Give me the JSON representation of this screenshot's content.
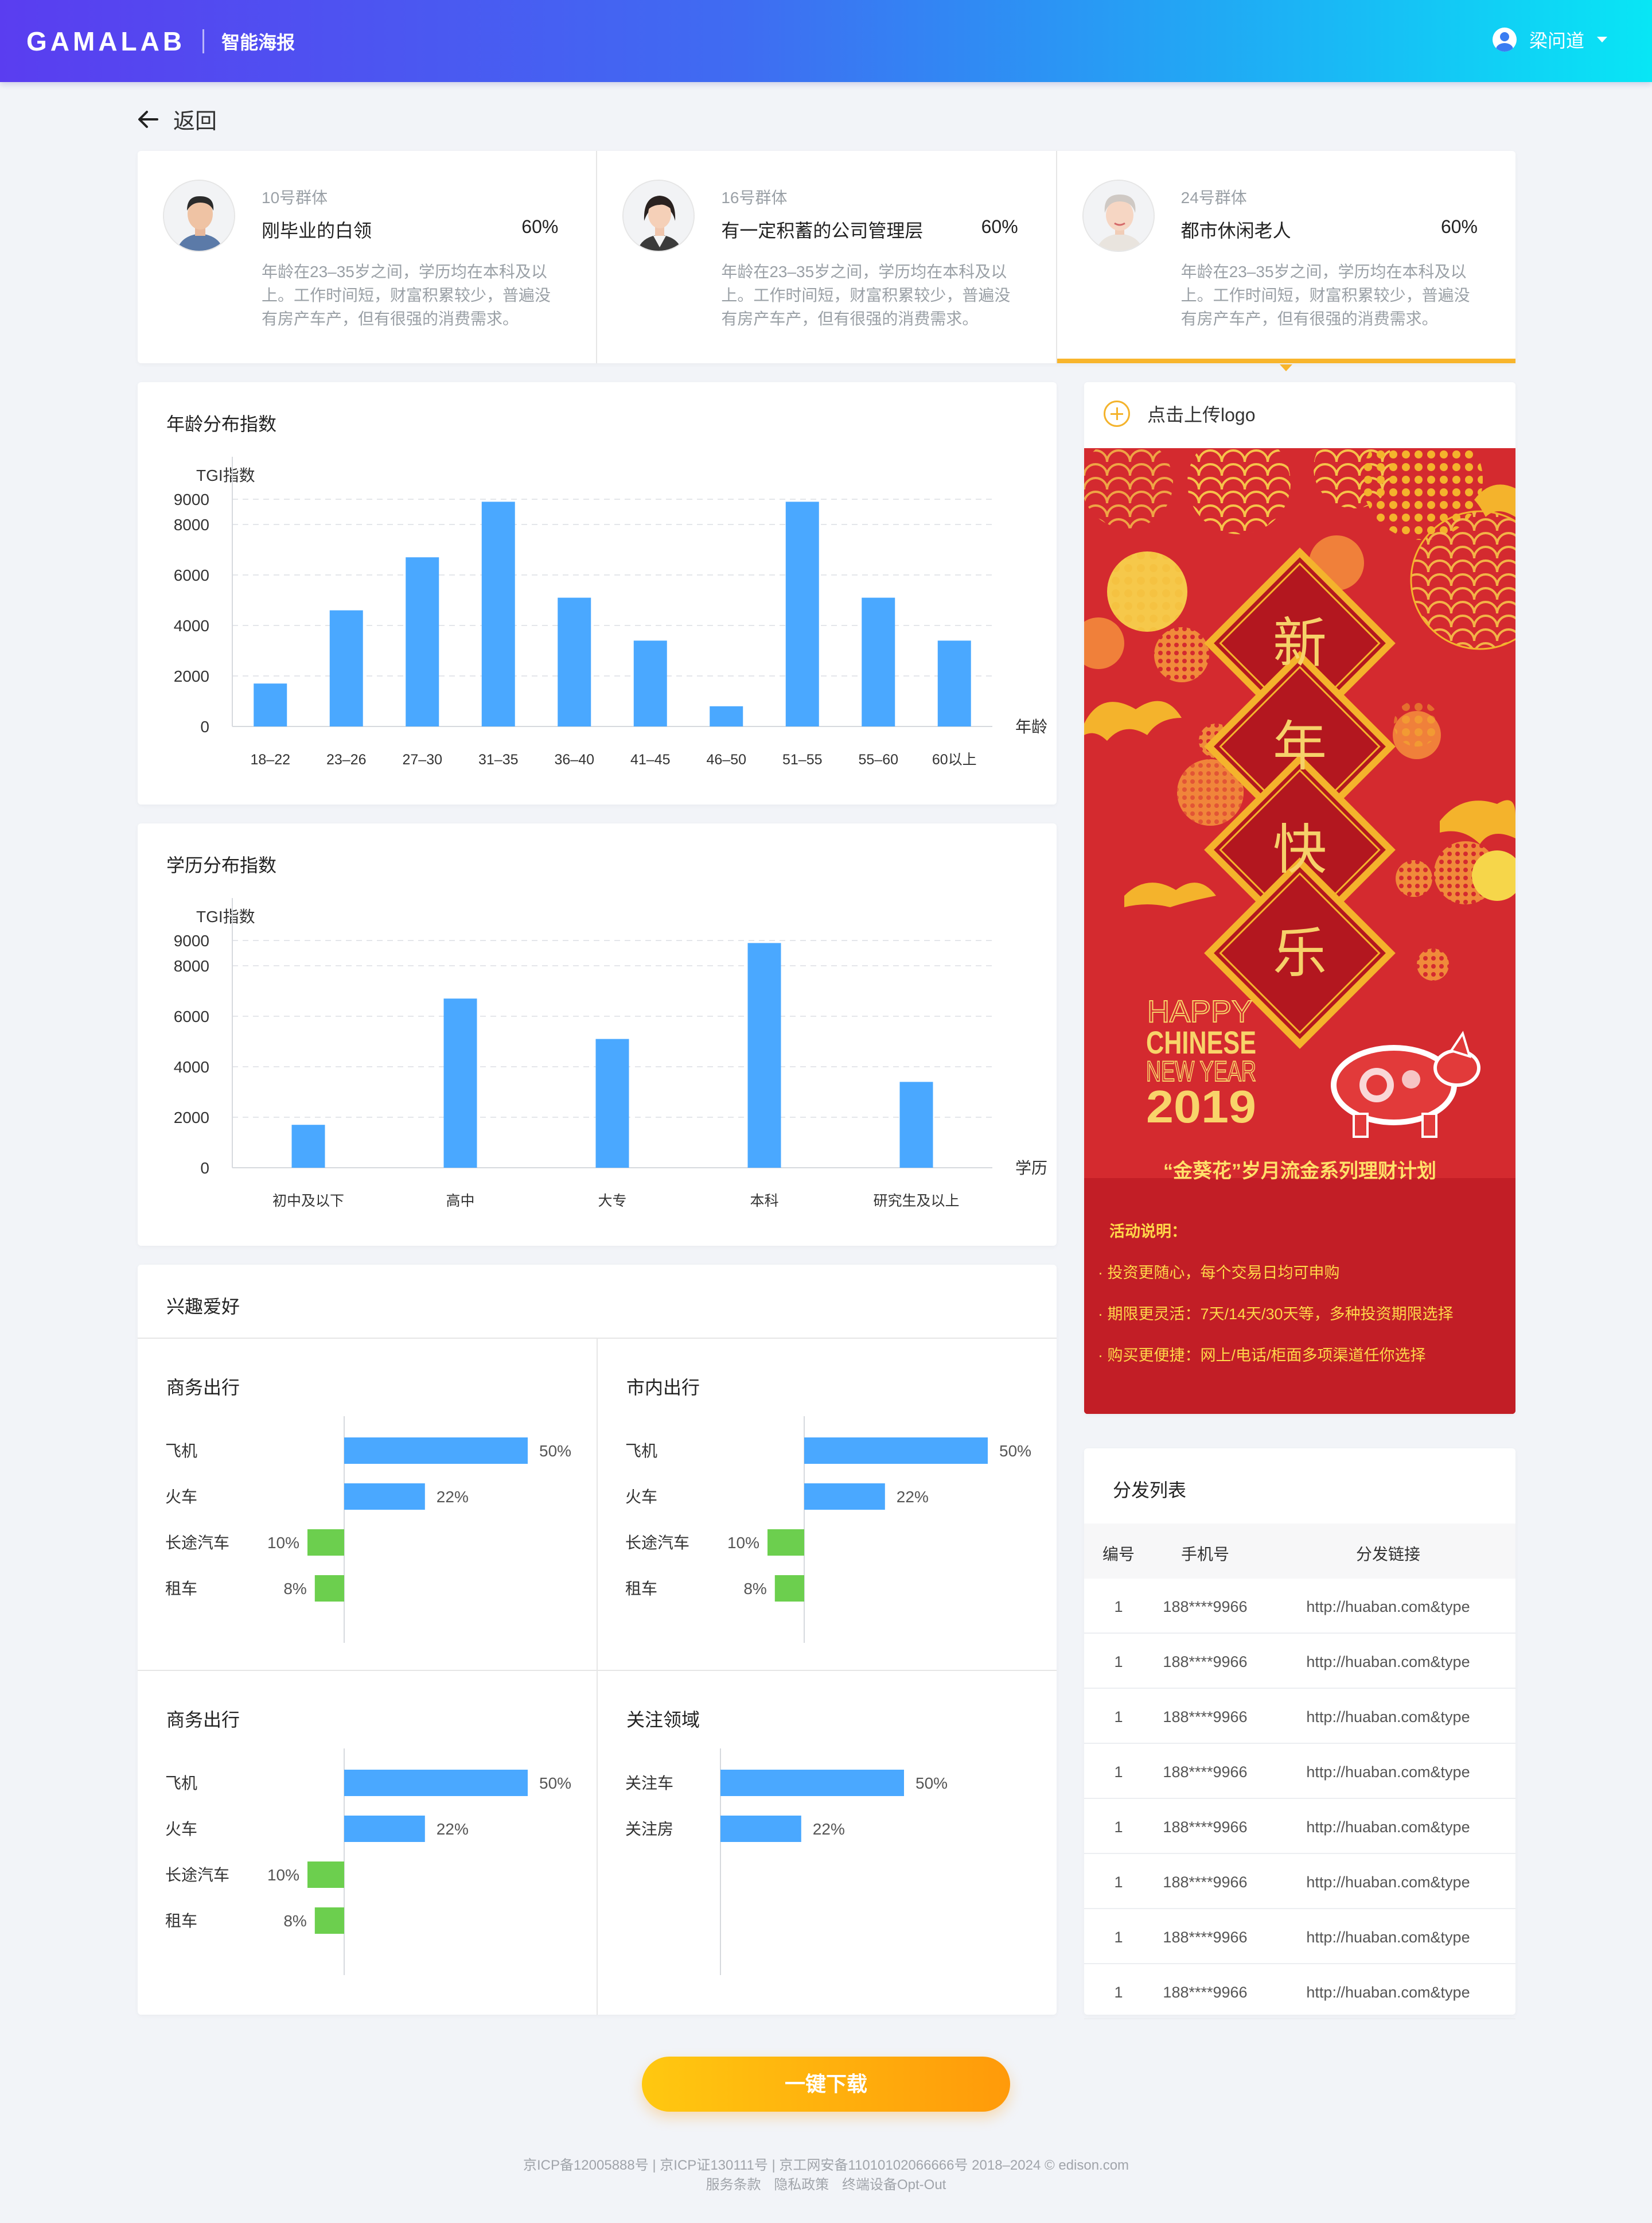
{
  "header": {
    "logo": "GAMALAB",
    "product": "智能海报",
    "user": "梁问道"
  },
  "back_label": "返回",
  "personas": [
    {
      "group": "10号群体",
      "name": "刚毕业的白领",
      "percent": "60%",
      "desc": "年龄在23–35岁之间，学历均在本科及以上。工作时间短，财富积累较少，普遍没有房产车产，但有很强的消费需求。"
    },
    {
      "group": "16号群体",
      "name": "有一定积蓄的公司管理层",
      "percent": "60%",
      "desc": "年龄在23–35岁之间，学历均在本科及以上。工作时间短，财富积累较少，普遍没有房产车产，但有很强的消费需求。"
    },
    {
      "group": "24号群体",
      "name": "都市休闲老人",
      "percent": "60%",
      "desc": "年龄在23–35岁之间，学历均在本科及以上。工作时间短，财富积累较少，普遍没有房产车产，但有很强的消费需求。"
    }
  ],
  "age_chart": {
    "title": "年龄分布指数",
    "ylabel": "TGI指数",
    "xlabel": "年龄"
  },
  "edu_chart": {
    "title": "学历分布指数",
    "ylabel": "TGI指数",
    "xlabel": "学历"
  },
  "chart_data": [
    {
      "type": "bar",
      "title": "年龄分布指数",
      "ylabel": "TGI指数",
      "xlabel": "年龄",
      "categories": [
        "18–22",
        "23–26",
        "27–30",
        "31–35",
        "36–40",
        "41–45",
        "46–50",
        "51–55",
        "55–60",
        "60以上"
      ],
      "values": [
        1700,
        4600,
        6700,
        8900,
        5100,
        3400,
        800,
        8900,
        5100,
        3400
      ],
      "yticks": [
        0,
        2000,
        4000,
        6000,
        8000,
        9000
      ],
      "ylim": [
        0,
        10000
      ],
      "color": "#4aa8ff",
      "grid": true
    },
    {
      "type": "bar",
      "title": "学历分布指数",
      "ylabel": "TGI指数",
      "xlabel": "学历",
      "categories": [
        "初中及以下",
        "高中",
        "大专",
        "本科",
        "研究生及以上"
      ],
      "values": [
        1700,
        6700,
        5100,
        8900,
        3400
      ],
      "yticks": [
        0,
        2000,
        4000,
        6000,
        8000,
        9000
      ],
      "ylim": [
        0,
        10000
      ],
      "color": "#4aa8ff",
      "grid": true
    },
    {
      "type": "bar",
      "title": "商务出行",
      "orientation": "horizontal",
      "categories": [
        "飞机",
        "火车",
        "长途汽车",
        "租车"
      ],
      "values": [
        50,
        22,
        -10,
        -8
      ],
      "labels": [
        "50%",
        "22%",
        "10%",
        "8%"
      ]
    },
    {
      "type": "bar",
      "title": "市内出行",
      "orientation": "horizontal",
      "categories": [
        "飞机",
        "火车",
        "长途汽车",
        "租车"
      ],
      "values": [
        50,
        22,
        -10,
        -8
      ],
      "labels": [
        "50%",
        "22%",
        "10%",
        "8%"
      ]
    },
    {
      "type": "bar",
      "title": "商务出行",
      "orientation": "horizontal",
      "categories": [
        "飞机",
        "火车",
        "长途汽车",
        "租车"
      ],
      "values": [
        50,
        22,
        -10,
        -8
      ],
      "labels": [
        "50%",
        "22%",
        "10%",
        "8%"
      ]
    },
    {
      "type": "bar",
      "title": "关注领域",
      "orientation": "horizontal",
      "categories": [
        "关注车",
        "关注房"
      ],
      "values": [
        50,
        22
      ],
      "labels": [
        "50%",
        "22%"
      ]
    }
  ],
  "interests": {
    "title": "兴趣爱好",
    "positive_color": "#4aa8ff",
    "negative_color": "#6ccf4e"
  },
  "poster": {
    "upload_label": "点击上传logo",
    "chars": [
      "新",
      "年",
      "快",
      "乐"
    ],
    "happy": "HAPPY",
    "chinese": "CHINESE",
    "new_year": "NEW YEAR",
    "year": "2019",
    "campaign": "“金葵花”岁月流金系列理财计划",
    "activity_title": "活动说明：",
    "activity_items": [
      "· 投资更随心，每个交易日均可申购",
      "· 期限更灵活：7天/14天/30天等，多种投资期限选择",
      "· 购买更便捷：网上/电话/柜面多项渠道任你选择"
    ]
  },
  "distribution": {
    "title": "分发列表",
    "headers": [
      "编号",
      "手机号",
      "分发链接"
    ],
    "rows": [
      [
        "1",
        "188****9966",
        "http://huaban.com&type"
      ],
      [
        "1",
        "188****9966",
        "http://huaban.com&type"
      ],
      [
        "1",
        "188****9966",
        "http://huaban.com&type"
      ],
      [
        "1",
        "188****9966",
        "http://huaban.com&type"
      ],
      [
        "1",
        "188****9966",
        "http://huaban.com&type"
      ],
      [
        "1",
        "188****9966",
        "http://huaban.com&type"
      ],
      [
        "1",
        "188****9966",
        "http://huaban.com&type"
      ],
      [
        "1",
        "188****9966",
        "http://huaban.com&type"
      ]
    ]
  },
  "download_label": "一键下载",
  "footer": {
    "line1": "京ICP备12005888号 | 京ICP证130111号 | 京工网安备11010102066666号 2018–2024 © edison.com",
    "links": [
      "服务条款",
      "隐私政策",
      "终端设备Opt-Out"
    ]
  }
}
